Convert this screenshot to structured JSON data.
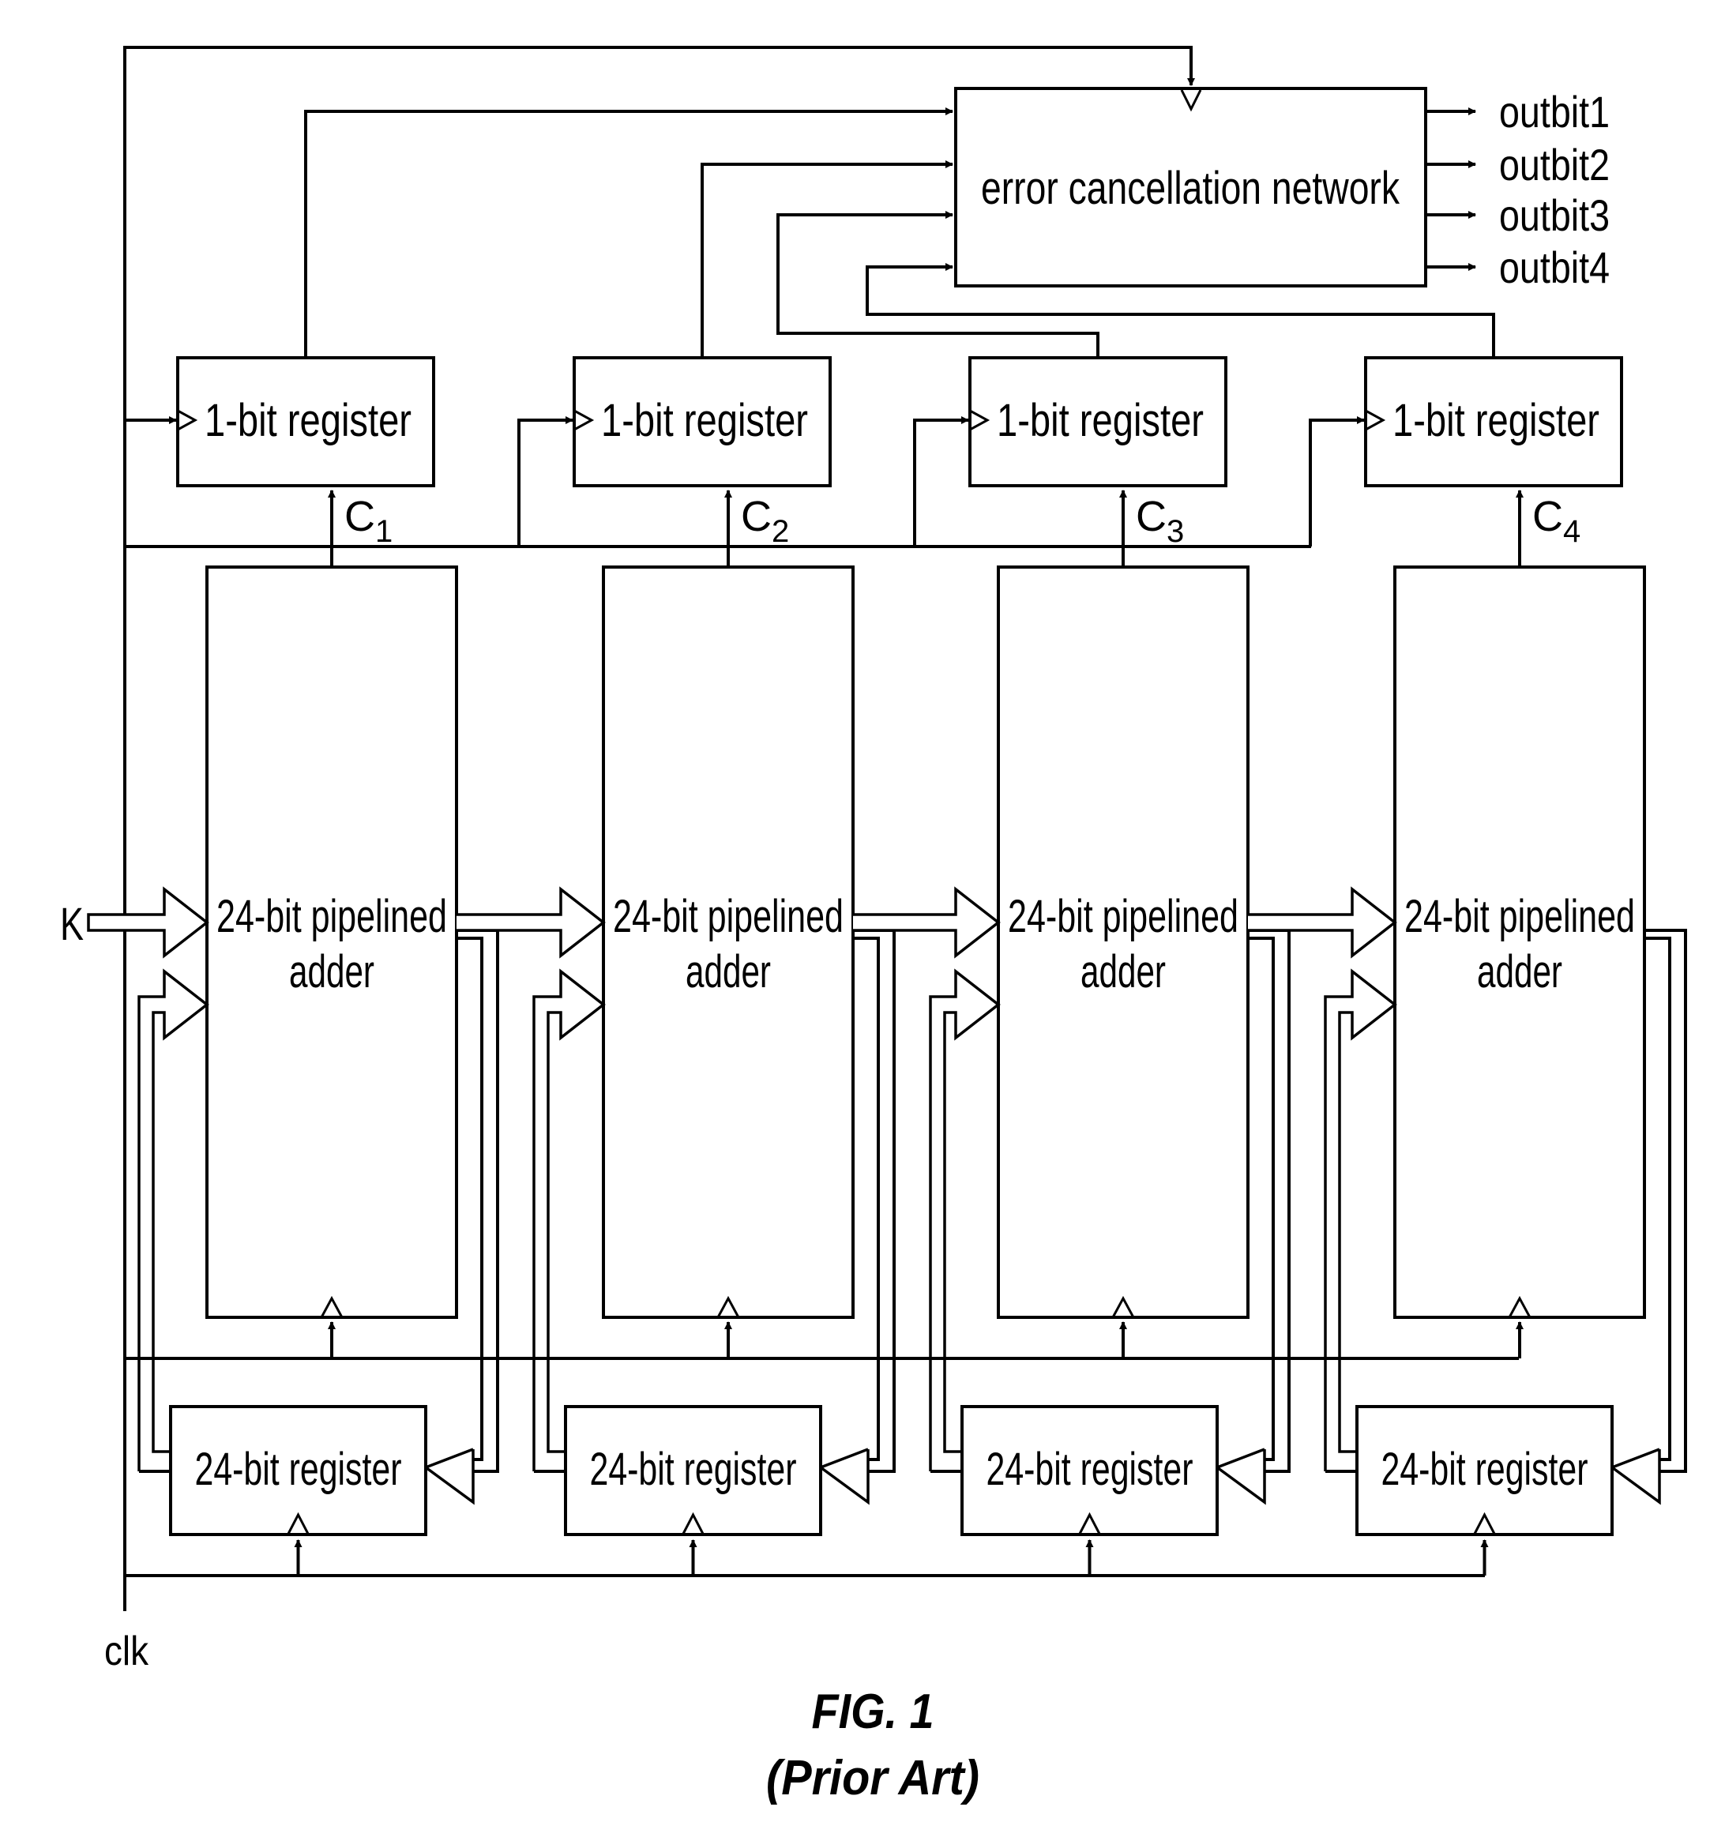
{
  "figure": {
    "caption_line1": "FIG. 1",
    "caption_line2": "(Prior Art)"
  },
  "signals": {
    "clock": "clk",
    "input": "K"
  },
  "error_network": {
    "label": "error cancellation network",
    "outputs": [
      "outbit1",
      "outbit2",
      "outbit3",
      "outbit4"
    ]
  },
  "stages": [
    {
      "adder_line1": "24-bit pipelined",
      "adder_line2": "adder",
      "feedback_register": "24-bit register",
      "carry_register": "1-bit register",
      "carry": "C",
      "carry_index": "1"
    },
    {
      "adder_line1": "24-bit pipelined",
      "adder_line2": "adder",
      "feedback_register": "24-bit register",
      "carry_register": "1-bit register",
      "carry": "C",
      "carry_index": "2"
    },
    {
      "adder_line1": "24-bit pipelined",
      "adder_line2": "adder",
      "feedback_register": "24-bit register",
      "carry_register": "1-bit register",
      "carry": "C",
      "carry_index": "3"
    },
    {
      "adder_line1": "24-bit pipelined",
      "adder_line2": "adder",
      "feedback_register": "24-bit register",
      "carry_register": "1-bit register",
      "carry": "C",
      "carry_index": "4"
    }
  ]
}
